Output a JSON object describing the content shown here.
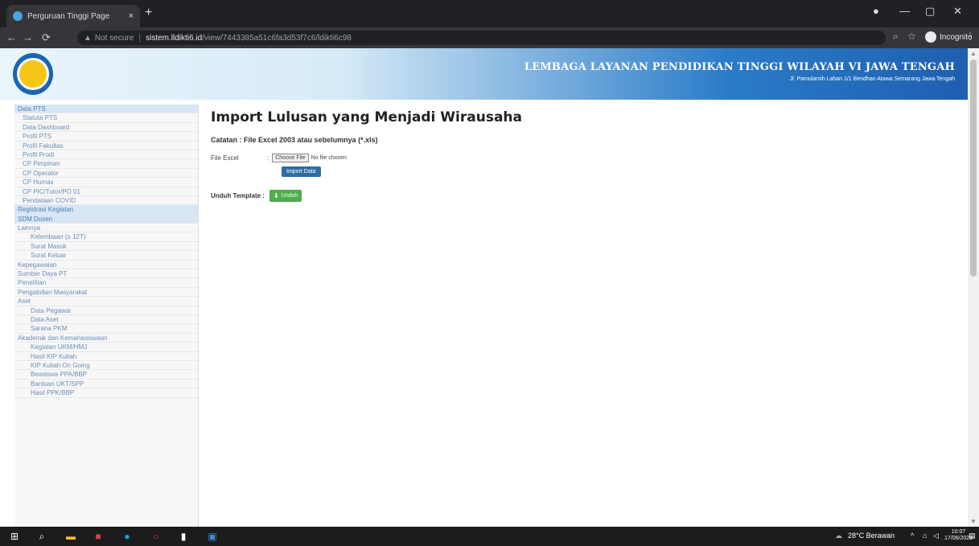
{
  "browser": {
    "tab_title": "Perguruan Tinggi Page",
    "tab_close": "×",
    "new_tab": "+",
    "address": {
      "security_label": "Not secure",
      "host": "sistem.lldikti6.id",
      "path": "/view/7443385a51c6fa3d53f7c6/ldikti6c98"
    },
    "profile_label": "Incognito",
    "window_controls": [
      "●",
      "—",
      "▢",
      "✕"
    ]
  },
  "header": {
    "title": "LEMBAGA LAYANAN PENDIDIKAN TINGGI WILAYAH VI JAWA TENGAH",
    "subtitle": "Jl. Pamularsih Lahan 1/1 Bendhan Atawa Semarang Jawa Tengah"
  },
  "sidebar": {
    "items": [
      {
        "label": "Data PTS",
        "level": 0,
        "highlight": true
      },
      {
        "label": "Statuta PTS",
        "level": 1,
        "highlight": false
      },
      {
        "label": "Data Dashboard",
        "level": 1,
        "highlight": false
      },
      {
        "label": "Profil PTS",
        "level": 1,
        "highlight": false
      },
      {
        "label": "Profil Fakultas",
        "level": 1,
        "highlight": false
      },
      {
        "label": "Profil Prodi",
        "level": 1,
        "highlight": false
      },
      {
        "label": "CP Pimpinan",
        "level": 1,
        "highlight": false
      },
      {
        "label": "CP Operator",
        "level": 1,
        "highlight": false
      },
      {
        "label": "CP Humas",
        "level": 1,
        "highlight": false
      },
      {
        "label": "CP PIC/Tutor/PO 01",
        "level": 1,
        "highlight": false
      },
      {
        "label": "Pendataan COVID",
        "level": 1,
        "highlight": false
      },
      {
        "label": "Registrasi Kegiatan",
        "level": 0,
        "highlight": true
      },
      {
        "label": "SDM Dosen",
        "level": 0,
        "highlight": true
      },
      {
        "label": "Lainnya",
        "level": 0,
        "highlight": false
      },
      {
        "label": "Kelembaan (≥ 12T)",
        "level": 2,
        "highlight": false
      },
      {
        "label": "Surat Masuk",
        "level": 2,
        "highlight": false
      },
      {
        "label": "Surat Keluar",
        "level": 2,
        "highlight": false
      },
      {
        "label": "Kepegawaian",
        "level": 0,
        "highlight": false
      },
      {
        "label": "Sumber Daya PT",
        "level": 0,
        "highlight": false
      },
      {
        "label": "Penelitian",
        "level": 0,
        "highlight": false
      },
      {
        "label": "Pengabdian Masyarakat",
        "level": 0,
        "highlight": false
      },
      {
        "label": "Aset",
        "level": 0,
        "highlight": false
      },
      {
        "label": "Data Pegawai",
        "level": 2,
        "highlight": false
      },
      {
        "label": "Data Aset",
        "level": 2,
        "highlight": false
      },
      {
        "label": "Sarana PKM",
        "level": 2,
        "highlight": false
      },
      {
        "label": "Akademik dan Kemahasiswaan",
        "level": 0,
        "highlight": false
      },
      {
        "label": "Kegiatan UKM/HMJ",
        "level": 2,
        "highlight": false
      },
      {
        "label": "Hasil KIP Kuliah",
        "level": 2,
        "highlight": false
      },
      {
        "label": "KIP Kuliah On Going",
        "level": 2,
        "highlight": false
      },
      {
        "label": "Beasiswa PPA/BBP",
        "level": 2,
        "highlight": false
      },
      {
        "label": "Bantuan UKT/SPP",
        "level": 2,
        "highlight": false
      },
      {
        "label": "Hasil PPK/BBP",
        "level": 2,
        "highlight": false
      }
    ]
  },
  "main": {
    "title": "Import Lulusan yang Menjadi Wirausaha",
    "note": "Catatan : File Excel 2003 atau sebelumnya (*.xls)",
    "file_label": "File Excel",
    "colon": ":",
    "choose_file": "Choose File",
    "no_file": "No file chosen",
    "import_button": "Import Data",
    "template_label": "Unduh Template :",
    "download_button": "Unduh"
  },
  "taskbar": {
    "weather": "28°C Berawan",
    "time": "10:07",
    "date": "17/06/2023"
  },
  "colors": {
    "header_dark": "#1e5fae",
    "import_button": "#2e6da4",
    "download_button": "#4cae4c",
    "sidebar_link": "#6a8db8"
  }
}
